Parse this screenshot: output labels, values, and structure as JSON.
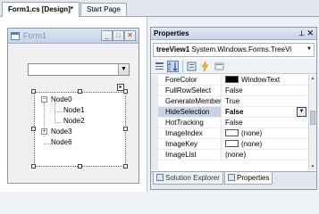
{
  "doc_tabs": {
    "active": "Form1.cs [Design]*",
    "inactive": "Start Page"
  },
  "form": {
    "title": "Form1",
    "buttons": {
      "minimize": "_",
      "maximize": "□",
      "close": "✕"
    },
    "combo_arrow": "▼",
    "tree_nodes": [
      {
        "label": "Node0",
        "expander": "−"
      },
      {
        "label": "Node1"
      },
      {
        "label": "Node2"
      },
      {
        "label": "Node3",
        "expander": "+"
      },
      {
        "label": "Node6"
      }
    ]
  },
  "properties": {
    "title": "Properties",
    "pin": "⊥",
    "close": "✕",
    "object_name": "treeView1",
    "object_type": "System.Windows.Forms.TreeVi",
    "object_arrow": "▼",
    "toolbar_icons": [
      "categorized-icon",
      "alphabetical-icon",
      "properties-icon",
      "events-icon",
      "property-pages-icon"
    ],
    "rows": [
      {
        "name": "ForeColor",
        "value": "WindowText",
        "swatch": "#000000"
      },
      {
        "name": "FullRowSelect",
        "value": "False"
      },
      {
        "name": "GenerateMember",
        "value": "True"
      },
      {
        "name": "HideSelection",
        "value": "False",
        "selected": true,
        "dropdown": "▼"
      },
      {
        "name": "HotTracking",
        "value": "False"
      },
      {
        "name": "ImageIndex",
        "value": "(none)",
        "swatch": "#ffffff"
      },
      {
        "name": "ImageKey",
        "value": "(none)",
        "swatch": "#ffffff"
      },
      {
        "name": "ImageList",
        "value": "(none)"
      }
    ],
    "bottom_tabs": {
      "solution": "Solution Explorer",
      "properties": "Properties"
    }
  }
}
